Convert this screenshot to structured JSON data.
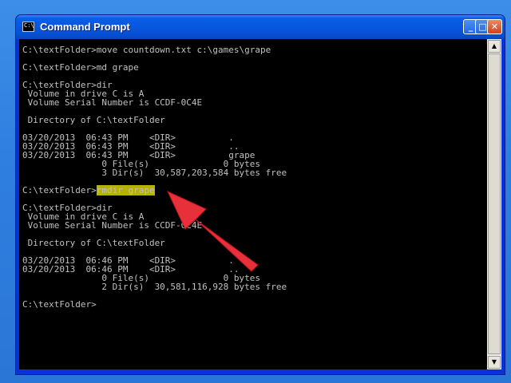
{
  "window": {
    "title": "Command Prompt",
    "icon_text": "C:\\",
    "controls": {
      "minimize": "_",
      "maximize": "□",
      "close": "✕"
    }
  },
  "console": {
    "lines": [
      "C:\\textFolder>move countdown.txt c:\\games\\grape",
      "",
      "C:\\textFolder>md grape",
      "",
      "C:\\textFolder>dir",
      " Volume in drive C is A",
      " Volume Serial Number is CCDF-0C4E",
      "",
      " Directory of C:\\textFolder",
      "",
      "03/20/2013  06:43 PM    <DIR>          .",
      "03/20/2013  06:43 PM    <DIR>          ..",
      "03/20/2013  06:43 PM    <DIR>          grape",
      "               0 File(s)              0 bytes",
      "               3 Dir(s)  30,587,203,584 bytes free",
      "",
      "C:\\textFolder>",
      "C:\\textFolder>dir",
      " Volume in drive C is A",
      " Volume Serial Number is CCDF-0C4E",
      "",
      " Directory of C:\\textFolder",
      "",
      "03/20/2013  06:46 PM    <DIR>          .",
      "03/20/2013  06:46 PM    <DIR>          ..",
      "               0 File(s)              0 bytes",
      "               2 Dir(s)  30,581,116,928 bytes free",
      "",
      "C:\\textFolder>"
    ],
    "highlighted_command": "rmdir grape"
  },
  "annotation": {
    "arrow_color": "#e8303a"
  },
  "scrollbar": {
    "up": "▲",
    "down": "▼"
  }
}
